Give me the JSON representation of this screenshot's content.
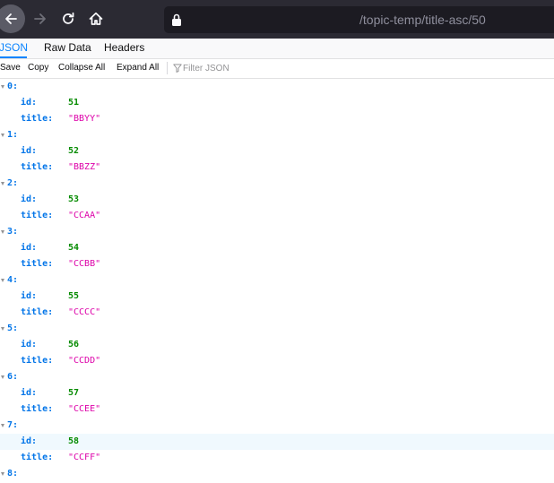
{
  "browser": {
    "url": "/topic-temp/title-asc/50",
    "colors": {
      "toolbar": "#2b2a33",
      "urlbar": "#1c1b22"
    }
  },
  "viewer": {
    "tabs": [
      {
        "label": "JSON",
        "active": true
      },
      {
        "label": "Raw Data",
        "active": false
      },
      {
        "label": "Headers",
        "active": false
      }
    ],
    "toolbar": {
      "save": "Save",
      "copy": "Copy",
      "collapse_all": "Collapse All",
      "expand_all": "Expand All",
      "filter_placeholder": "Filter JSON"
    }
  },
  "tree": {
    "key_id": "id:",
    "key_title": "title:",
    "items": [
      {
        "index": "0:",
        "id": "51",
        "title": "\"BBYY\""
      },
      {
        "index": "1:",
        "id": "52",
        "title": "\"BBZZ\""
      },
      {
        "index": "2:",
        "id": "53",
        "title": "\"CCAA\""
      },
      {
        "index": "3:",
        "id": "54",
        "title": "\"CCBB\""
      },
      {
        "index": "4:",
        "id": "55",
        "title": "\"CCCC\""
      },
      {
        "index": "5:",
        "id": "56",
        "title": "\"CCDD\""
      },
      {
        "index": "6:",
        "id": "57",
        "title": "\"CCEE\""
      },
      {
        "index": "7:",
        "id": "58",
        "title": "\"CCFF\"",
        "highlight_id_row": true
      },
      {
        "index": "8:"
      }
    ],
    "colors": {
      "key": "#0074e8",
      "number": "#058b00",
      "string": "#dd00a9"
    }
  }
}
